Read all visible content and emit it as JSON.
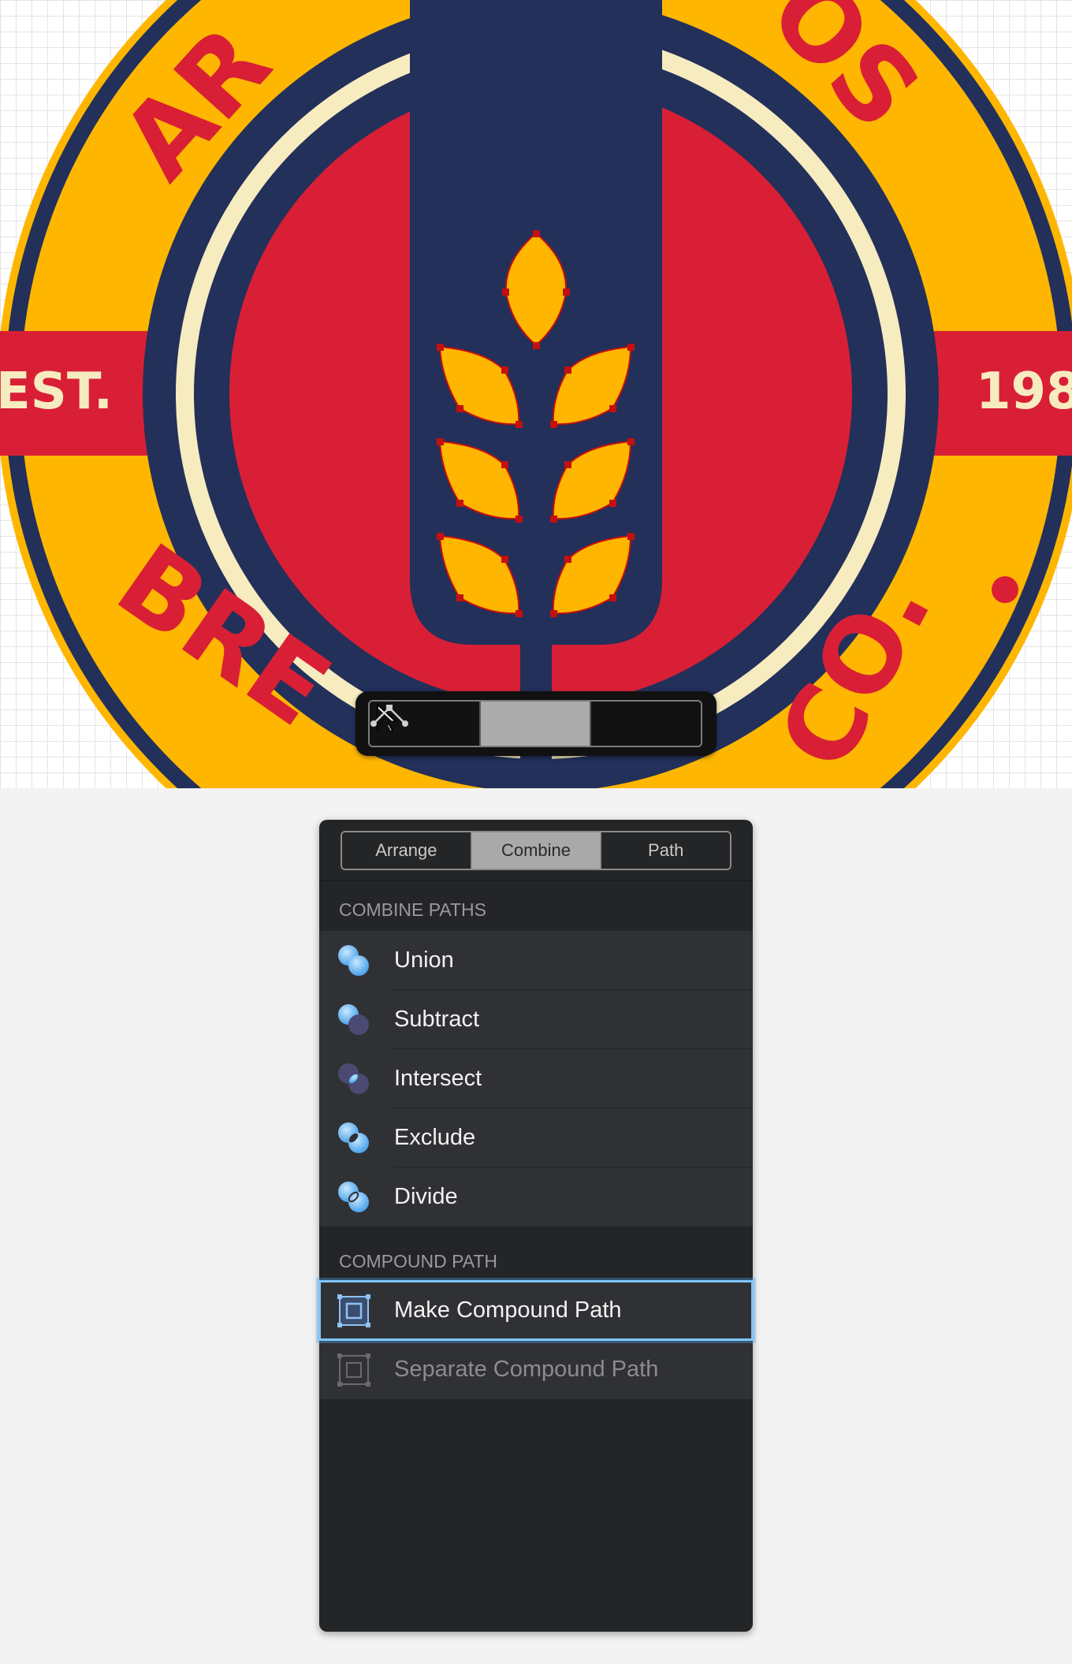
{
  "badge": {
    "top_arc_text": "AR",
    "top_right_arc_text": "OS",
    "bottom_left_arc_text": "BRE",
    "bottom_right_arc_text": "CO.",
    "ribbon_left": "EST.",
    "ribbon_right": "198",
    "colors": {
      "yellow": "#FFB600",
      "navy": "#22305A",
      "red": "#D91F35",
      "cream": "#F7EBC0",
      "anchor_red": "#C41010"
    }
  },
  "tool_bar": {
    "tools": [
      {
        "icon": "selection-arrow-icon",
        "active": false
      },
      {
        "icon": "add-selection-arrow-icon",
        "active": true
      },
      {
        "icon": "node-edit-icon",
        "active": false
      }
    ]
  },
  "panel": {
    "tabs": [
      {
        "label": "Arrange",
        "active": false
      },
      {
        "label": "Combine",
        "active": true
      },
      {
        "label": "Path",
        "active": false
      }
    ],
    "combine_paths_header": "COMBINE PATHS",
    "combine_items": [
      {
        "label": "Union",
        "icon": "union-icon"
      },
      {
        "label": "Subtract",
        "icon": "subtract-icon"
      },
      {
        "label": "Intersect",
        "icon": "intersect-icon"
      },
      {
        "label": "Exclude",
        "icon": "exclude-icon"
      },
      {
        "label": "Divide",
        "icon": "divide-icon"
      }
    ],
    "compound_path_header": "COMPOUND PATH",
    "compound_items": [
      {
        "label": "Make Compound Path",
        "icon": "make-compound-path-icon",
        "selected": true,
        "enabled": true
      },
      {
        "label": "Separate Compound Path",
        "icon": "separate-compound-path-icon",
        "selected": false,
        "enabled": false
      }
    ]
  }
}
